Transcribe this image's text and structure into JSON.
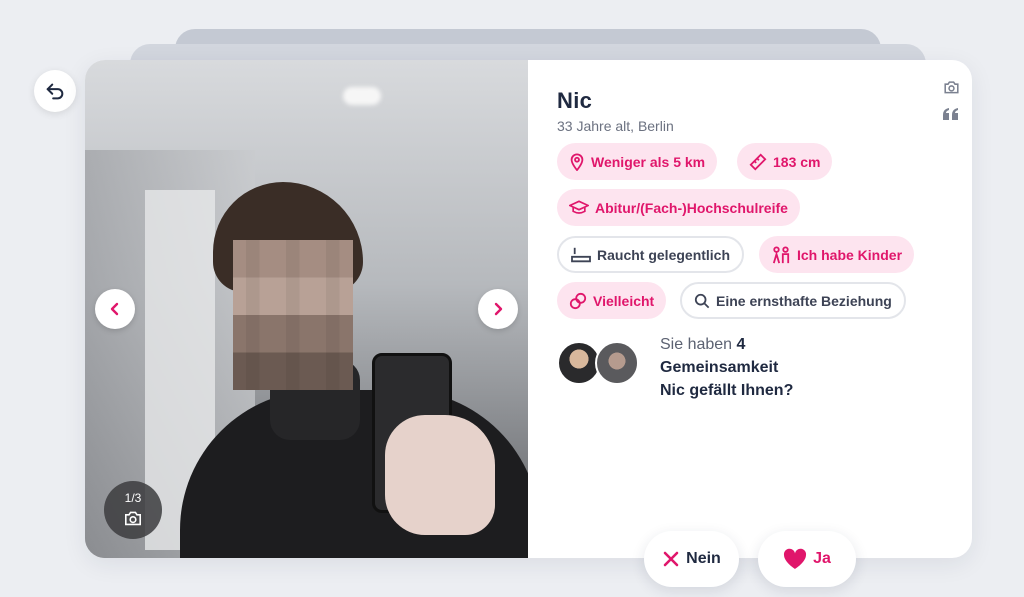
{
  "profile": {
    "name": "Nic",
    "subtitle": "33 Jahre alt, Berlin"
  },
  "photo": {
    "counter": "1/3"
  },
  "chips": [
    {
      "label": "Weniger als 5 km",
      "icon": "location-pin-icon",
      "style": "pink"
    },
    {
      "label": "183 cm",
      "icon": "ruler-icon",
      "style": "pink"
    },
    {
      "label": "Abitur/(Fach-)Hochschulreife",
      "icon": "graduation-cap-icon",
      "style": "pink"
    },
    {
      "label": "Raucht gelegentlich",
      "icon": "cigarette-icon",
      "style": "outline"
    },
    {
      "label": "Ich habe Kinder",
      "icon": "family-icon",
      "style": "pink"
    },
    {
      "label": "Vielleicht",
      "icon": "rings-icon",
      "style": "pink"
    },
    {
      "label": "Eine ernsthafte Beziehung",
      "icon": "search-icon",
      "style": "outline"
    }
  ],
  "commons": {
    "lead": "Sie haben",
    "count": "4",
    "label": "Gemeinsamkeit",
    "question": "Nic gefällt Ihnen?"
  },
  "actions": {
    "no_label": "Nein",
    "yes_label": "Ja"
  },
  "colors": {
    "accent": "#e0166b",
    "chip_bg": "#fde4ef",
    "text_dark": "#1f2940",
    "page_bg": "#eceef2"
  }
}
